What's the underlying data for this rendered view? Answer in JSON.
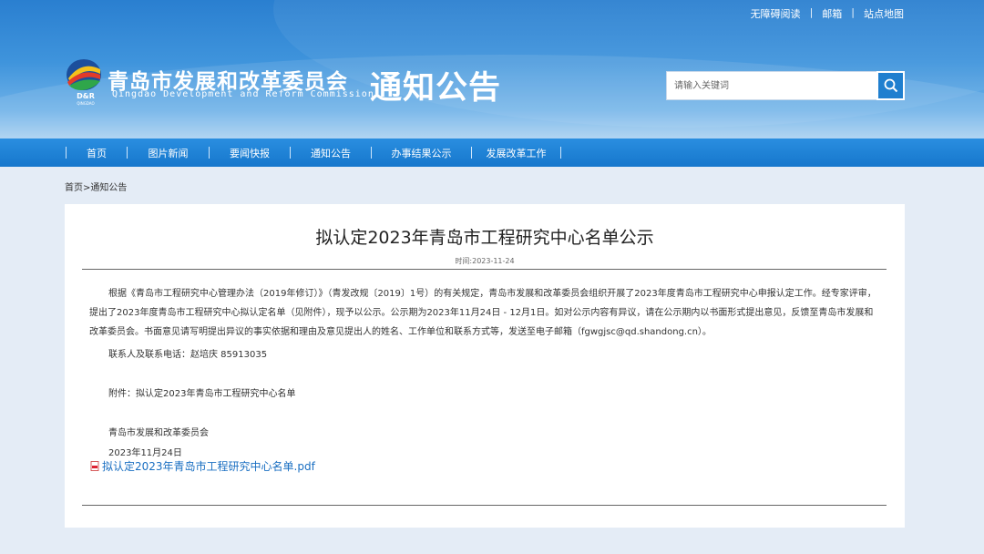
{
  "toplinks": {
    "accessible": "无障碍阅读",
    "mail": "邮箱",
    "sitemap": "站点地图",
    "sep": "|"
  },
  "logo": {
    "cn": "青岛市发展和改革委员会",
    "en": "Qingdao Development and Reform Commission",
    "mark_top": "D&R",
    "mark_bottom": "QINGDAO"
  },
  "section_title": "通知公告",
  "search": {
    "placeholder": "请输入关键词"
  },
  "nav": [
    "首页",
    "图片新闻",
    "要闻快报",
    "通知公告",
    "办事结果公示",
    "发展改革工作"
  ],
  "breadcrumb": {
    "home": "首页",
    "sep": ">",
    "current": "通知公告"
  },
  "article": {
    "title": "拟认定2023年青岛市工程研究中心名单公示",
    "time": "时间:2023-11-24",
    "paragraph": "根据《青岛市工程研究中心管理办法（2019年修订）》（青发改规〔2019〕1号）的有关规定，青岛市发展和改革委员会组织开展了2023年度青岛市工程研究中心申报认定工作。经专家评审，提出了2023年度青岛市工程研究中心拟认定名单（见附件），现予以公示。公示期为2023年11月24日 - 12月1日。如对公示内容有异议，请在公示期内以书面形式提出意见，反馈至青岛市发展和改革委员会。书面意见请写明提出异议的事实依据和理由及意见提出人的姓名、工作单位和联系方式等，发送至电子邮箱（fgwgjsc@qd.shandong.cn）。",
    "contact": "联系人及联系电话：赵培庆    85913035",
    "attachment": "附件：拟认定2023年青岛市工程研究中心名单",
    "signature": "青岛市发展和改革委员会",
    "date": "2023年11月24日",
    "pdf_link": "拟认定2023年青岛市工程研究中心名单.pdf"
  },
  "colors": {
    "header": "#2a7fd0",
    "nav": "#1677cc",
    "link": "#1a6fc2"
  }
}
